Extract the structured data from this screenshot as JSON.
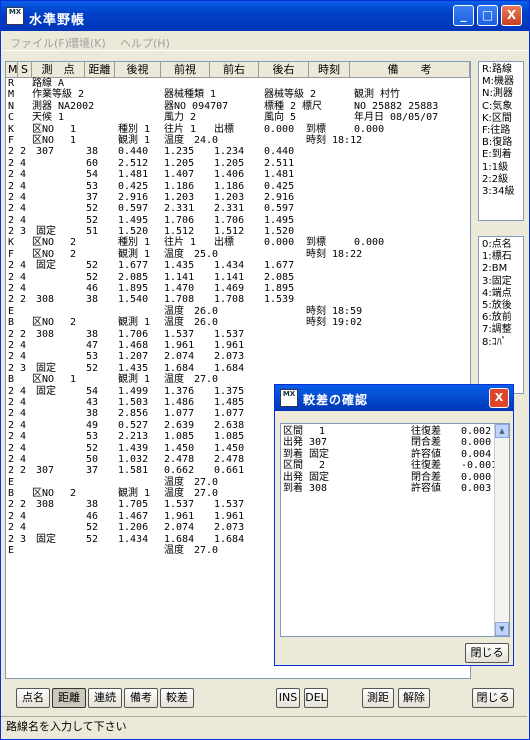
{
  "window": {
    "title": "水準野帳",
    "app_icon_top": "MX",
    "min": "_",
    "max": "□",
    "close": "X"
  },
  "menu": [
    {
      "label": "ファイル(F)"
    },
    {
      "label": "環境(K)"
    },
    {
      "label": "ヘルプ(H)"
    }
  ],
  "columns": [
    "M",
    "S",
    "測　点",
    "距離",
    "後視",
    "前視",
    "前右",
    "後右",
    "時刻",
    "備　　考"
  ],
  "rows": [
    [
      "R",
      "",
      "路線 A",
      "",
      "",
      "",
      "",
      "",
      "",
      ""
    ],
    [
      "M",
      "",
      "作業等級 2",
      "",
      "",
      "器械種類 1",
      "",
      "器械等級 2",
      "",
      "観測 村竹"
    ],
    [
      "N",
      "",
      "測器 NA2002",
      "",
      "",
      "器NO 094707",
      "",
      "標種 2 標尺",
      "",
      "NO 25882 25883"
    ],
    [
      "C",
      "",
      "天候 1",
      "",
      "",
      "風力 2",
      "",
      "風向 5",
      "",
      "年月日 08/05/07"
    ],
    [
      "K",
      "",
      "区NO　 1",
      "",
      "種別 1",
      "往片 1",
      "出標",
      "0.000",
      "到標",
      "0.000"
    ],
    [
      "F",
      "",
      "区NO　 1",
      "",
      "観測 1",
      "温度　24.0",
      "",
      "",
      "時刻 18:12",
      ""
    ],
    [
      "2 2",
      "",
      "307",
      "38",
      "0.440",
      "1.235",
      "1.234",
      "0.440",
      "",
      ""
    ],
    [
      "2 4",
      "",
      "",
      "60",
      "2.512",
      "1.205",
      "1.205",
      "2.511",
      "",
      ""
    ],
    [
      "2 4",
      "",
      "",
      "54",
      "1.481",
      "1.407",
      "1.406",
      "1.481",
      "",
      ""
    ],
    [
      "2 4",
      "",
      "",
      "53",
      "0.425",
      "1.186",
      "1.186",
      "0.425",
      "",
      ""
    ],
    [
      "2 4",
      "",
      "",
      "37",
      "2.916",
      "1.203",
      "1.203",
      "2.916",
      "",
      ""
    ],
    [
      "2 4",
      "",
      "",
      "52",
      "0.597",
      "2.331",
      "2.331",
      "0.597",
      "",
      ""
    ],
    [
      "2 4",
      "",
      "",
      "52",
      "1.495",
      "1.706",
      "1.706",
      "1.495",
      "",
      ""
    ],
    [
      "2 3",
      "",
      "固定",
      "51",
      "1.520",
      "1.512",
      "1.512",
      "1.520",
      "",
      ""
    ],
    [
      "K",
      "",
      "区NO　 2",
      "",
      "種別 1",
      "往片 1",
      "出標",
      "0.000",
      "到標",
      "0.000"
    ],
    [
      "F",
      "",
      "区NO　 2",
      "",
      "観測 1",
      "温度　25.0",
      "",
      "",
      "時刻 18:22",
      ""
    ],
    [
      "2 4",
      "",
      "固定",
      "52",
      "1.677",
      "1.435",
      "1.434",
      "1.677",
      "",
      ""
    ],
    [
      "2 4",
      "",
      "",
      "52",
      "2.085",
      "1.141",
      "1.141",
      "2.085",
      "",
      ""
    ],
    [
      "2 4",
      "",
      "",
      "46",
      "1.895",
      "1.470",
      "1.469",
      "1.895",
      "",
      ""
    ],
    [
      "2 2",
      "",
      "308",
      "38",
      "1.540",
      "1.708",
      "1.708",
      "1.539",
      "",
      ""
    ],
    [
      "E",
      "",
      "",
      "",
      "",
      "温度　26.0",
      "",
      "",
      "時刻 18:59",
      ""
    ],
    [
      "B",
      "",
      "区NO　 2",
      "",
      "観測 1",
      "温度　26.0",
      "",
      "",
      "時刻 19:02",
      ""
    ],
    [
      "2 2",
      "",
      "308",
      "38",
      "1.706",
      "1.537",
      "1.537",
      "",
      "",
      ""
    ],
    [
      "2 4",
      "",
      "",
      "47",
      "1.468",
      "1.961",
      "1.961",
      "",
      "",
      ""
    ],
    [
      "2 4",
      "",
      "",
      "53",
      "1.207",
      "2.074",
      "2.073",
      "",
      "",
      ""
    ],
    [
      "2 3",
      "",
      "固定",
      "52",
      "1.435",
      "1.684",
      "1.684",
      "",
      "",
      ""
    ],
    [
      "B",
      "",
      "区NO　 1",
      "",
      "観測 1",
      "温度　27.0",
      "",
      "",
      "",
      ""
    ],
    [
      "2 4",
      "",
      "固定",
      "54",
      "1.499",
      "1.376",
      "1.375",
      "",
      "",
      ""
    ],
    [
      "2 4",
      "",
      "",
      "43",
      "1.503",
      "1.486",
      "1.485",
      "",
      "",
      ""
    ],
    [
      "2 4",
      "",
      "",
      "38",
      "2.856",
      "1.077",
      "1.077",
      "",
      "",
      ""
    ],
    [
      "2 4",
      "",
      "",
      "49",
      "0.527",
      "2.639",
      "2.638",
      "",
      "",
      ""
    ],
    [
      "2 4",
      "",
      "",
      "53",
      "2.213",
      "1.085",
      "1.085",
      "",
      "",
      ""
    ],
    [
      "2 4",
      "",
      "",
      "52",
      "1.439",
      "1.450",
      "1.450",
      "",
      "",
      ""
    ],
    [
      "2 4",
      "",
      "",
      "50",
      "1.032",
      "2.478",
      "2.478",
      "",
      "",
      ""
    ],
    [
      "2 2",
      "",
      "307",
      "37",
      "1.581",
      "0.662",
      "0.661",
      "",
      "",
      ""
    ],
    [
      "E",
      "",
      "",
      "",
      "",
      "温度　27.0",
      "",
      "",
      "",
      ""
    ],
    [
      "B",
      "",
      "区NO　 2",
      "",
      "観測 1",
      "温度　27.0",
      "",
      "",
      "",
      ""
    ],
    [
      "2 2",
      "",
      "308",
      "38",
      "1.705",
      "1.537",
      "1.537",
      "",
      "",
      ""
    ],
    [
      "2 4",
      "",
      "",
      "46",
      "1.467",
      "1.961",
      "1.961",
      "",
      "",
      ""
    ],
    [
      "2 4",
      "",
      "",
      "52",
      "1.206",
      "2.074",
      "2.073",
      "",
      "",
      ""
    ],
    [
      "2 3",
      "",
      "固定",
      "52",
      "1.434",
      "1.684",
      "1.684",
      "",
      "",
      ""
    ],
    [
      "E",
      "",
      "",
      "",
      "",
      "温度　27.0",
      "",
      "",
      "",
      ""
    ]
  ],
  "side_top": [
    "R:路線",
    "M:機器",
    "N:測器",
    "C:気象",
    "K:区間",
    "F:往路",
    "B:復路",
    "E:到着",
    "1:1級",
    "2:2級",
    "3:34級"
  ],
  "side_bottom": [
    "0:点名",
    "1:標石",
    "2:BM",
    "3:固定",
    "4:端点",
    "5:放後",
    "6:放前",
    "7:調整",
    "8:ｺﾊﾟ"
  ],
  "buttons_left": [
    "点名",
    "距離",
    "連続",
    "備考",
    "較差"
  ],
  "buttons_mid": [
    "INS",
    "DEL"
  ],
  "buttons_right": [
    "測距",
    "解除"
  ],
  "close_button": "閉じる",
  "status": "路線名を入力して下さい",
  "dialog": {
    "title": "較差の確認",
    "lines": [
      [
        "区間　 1",
        "往復差",
        "0.002"
      ],
      [
        "出発 307",
        "閉合差",
        "0.000"
      ],
      [
        "到着 固定",
        "許容値",
        "0.004"
      ],
      [
        "区間　 2",
        "往復差",
        "-0.001"
      ],
      [
        "出発 固定",
        "閉合差",
        "0.000"
      ],
      [
        "到着 308",
        "許容値",
        "0.003"
      ]
    ],
    "close_label": "閉じる"
  }
}
